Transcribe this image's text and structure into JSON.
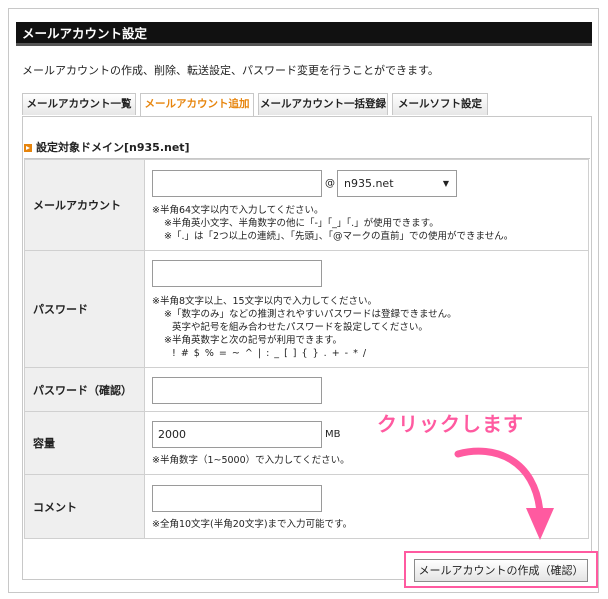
{
  "header": {
    "title": "メールアカウント設定"
  },
  "intro": "メールアカウントの作成、削除、転送設定、パスワード変更を行うことができます。",
  "tabs": [
    {
      "label": "メールアカウント一覧"
    },
    {
      "label": "メールアカウント追加"
    },
    {
      "label": "メールアカウント一括登録"
    },
    {
      "label": "メールソフト設定"
    }
  ],
  "section": {
    "title": "設定対象ドメイン[n935.net]"
  },
  "form": {
    "account": {
      "label": "メールアカウント",
      "value": "",
      "at": "@",
      "domain": "n935.net",
      "notes": [
        "※半角64文字以内で入力してください。",
        "※半角英小文字、半角数字の他に「-」「_」「.」が使用できます。",
        "※「.」は「2つ以上の連続」、「先頭」、「@マークの直前」での使用ができません。"
      ]
    },
    "password": {
      "label": "パスワード",
      "value": "",
      "notes": [
        "※半角8文字以上、15文字以内で入力してください。",
        "※「数字のみ」などの推測されやすいパスワードは登録できません。",
        "英字や記号を組み合わせたパスワードを設定してください。",
        "※半角英数字と次の記号が利用できます。",
        "! # $ % = ~ ^ | : _ [ ] { } . + - * /"
      ]
    },
    "password_confirm": {
      "label": "パスワード（確認）",
      "value": ""
    },
    "capacity": {
      "label": "容量",
      "value": "2000",
      "unit": "MB",
      "note": "※半角数字（1~5000）で入力してください。"
    },
    "comment": {
      "label": "コメント",
      "value": "",
      "note": "※全角10文字(半角20文字)まで入力可能です。"
    }
  },
  "confirm_button": {
    "label": "メールアカウントの作成（確認）"
  },
  "annotation": {
    "text": "クリックします",
    "color": "#ff5aa0"
  },
  "colors": {
    "accent": "#e7850d",
    "header_bg": "#111111",
    "label_bg": "#efefef"
  }
}
